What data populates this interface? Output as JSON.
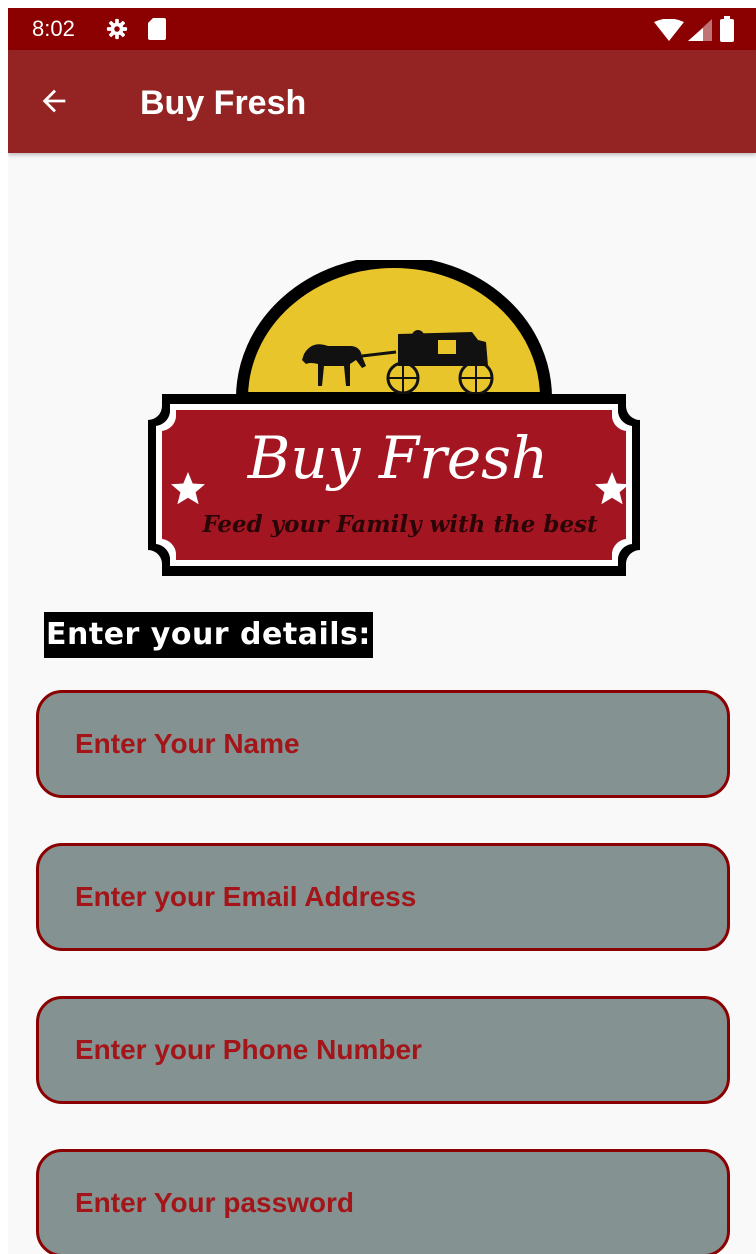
{
  "status_bar": {
    "time": "8:02",
    "icons": [
      "gear-icon",
      "sd-card-icon",
      "wifi-icon",
      "signal-icon",
      "battery-icon"
    ]
  },
  "app_bar": {
    "title": "Buy Fresh",
    "back_icon": "arrow-left-icon"
  },
  "logo": {
    "brand": "Buy Fresh",
    "tagline": "Feed your Family with the best"
  },
  "form": {
    "heading": "Enter your details:",
    "fields": [
      {
        "placeholder": "Enter Your Name"
      },
      {
        "placeholder": "Enter your Email Address"
      },
      {
        "placeholder": "Enter your Phone Number"
      },
      {
        "placeholder": "Enter Your password"
      }
    ]
  },
  "colors": {
    "status_bar": "#8b0000",
    "app_bar": "#942323",
    "field_fill": "#849291",
    "field_border": "#8b0000",
    "field_text": "#a31519",
    "logo_banner": "#a31621",
    "logo_sun": "#e9c52c"
  }
}
